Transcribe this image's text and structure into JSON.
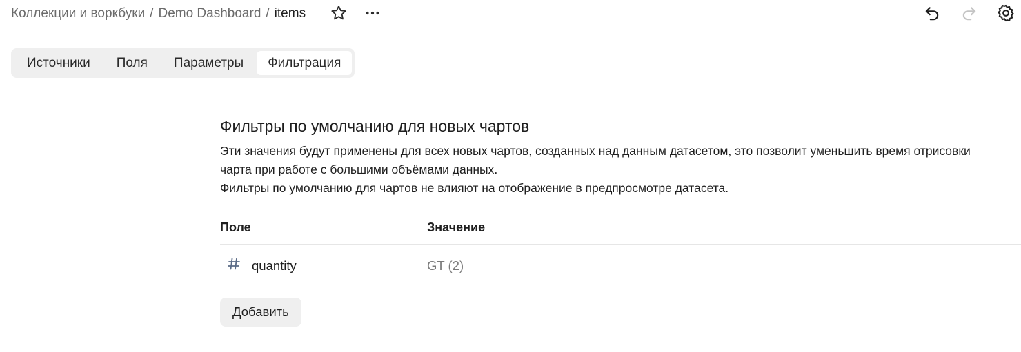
{
  "breadcrumb": {
    "items": [
      "Коллекции и воркбуки",
      "Demo Dashboard"
    ],
    "separator": "/",
    "current": "items"
  },
  "header_icons": [
    "star-icon",
    "more-icon",
    "undo-icon",
    "redo-icon",
    "gear-icon"
  ],
  "tabs": [
    {
      "label": "Источники",
      "active": false
    },
    {
      "label": "Поля",
      "active": false
    },
    {
      "label": "Параметры",
      "active": false
    },
    {
      "label": "Фильтрация",
      "active": true
    }
  ],
  "section": {
    "title": "Фильтры по умолчанию для новых чартов",
    "description_line1": "Эти значения будут применены для всех новых чартов, созданных над данным датасетом, это позволит уменьшить время отрисовки чарта при работе с большими объёмами данных.",
    "description_line2": "Фильтры по умолчанию для чартов не влияют на отображение в предпросмотре датасета."
  },
  "table": {
    "headers": {
      "field": "Поле",
      "value": "Значение"
    },
    "rows": [
      {
        "icon": "hash-icon",
        "field": "quantity",
        "value": "GT (2)"
      }
    ]
  },
  "add_button": "Добавить",
  "colors": {
    "muted_text": "#6b6b6b",
    "tab_bg": "#efefef",
    "border": "#e6e6e6"
  }
}
